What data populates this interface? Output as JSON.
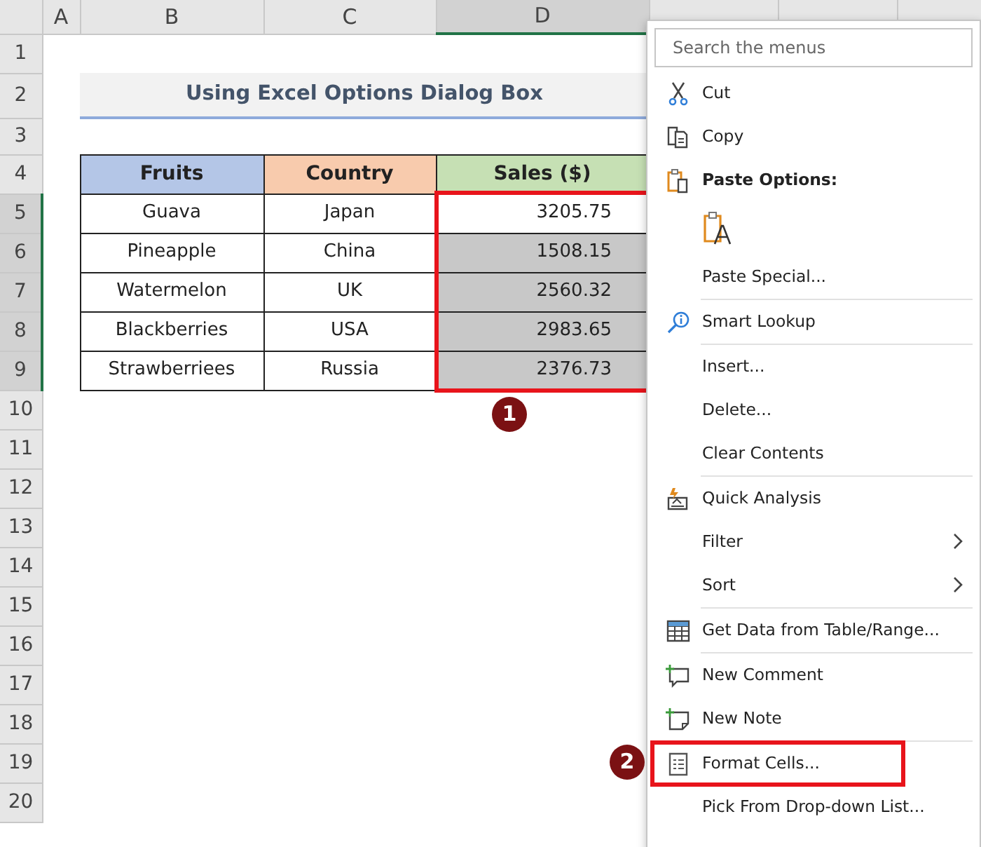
{
  "columns": [
    {
      "label": "A",
      "selected": false
    },
    {
      "label": "B",
      "selected": false
    },
    {
      "label": "C",
      "selected": false
    },
    {
      "label": "D",
      "selected": true
    }
  ],
  "rows": [
    {
      "label": "1",
      "selected": false
    },
    {
      "label": "2",
      "selected": false
    },
    {
      "label": "3",
      "selected": false
    },
    {
      "label": "4",
      "selected": false
    },
    {
      "label": "5",
      "selected": true
    },
    {
      "label": "6",
      "selected": true
    },
    {
      "label": "7",
      "selected": true
    },
    {
      "label": "8",
      "selected": true
    },
    {
      "label": "9",
      "selected": true
    },
    {
      "label": "10",
      "selected": false
    },
    {
      "label": "11",
      "selected": false
    },
    {
      "label": "12",
      "selected": false
    },
    {
      "label": "13",
      "selected": false
    },
    {
      "label": "14",
      "selected": false
    },
    {
      "label": "15",
      "selected": false
    },
    {
      "label": "16",
      "selected": false
    },
    {
      "label": "17",
      "selected": false
    },
    {
      "label": "18",
      "selected": false
    },
    {
      "label": "19",
      "selected": false
    },
    {
      "label": "20",
      "selected": false
    }
  ],
  "title": "Using Excel Options Dialog Box",
  "table": {
    "callout": "1",
    "headers": [
      {
        "label": "Fruits",
        "color": "#b4c6e7"
      },
      {
        "label": "Country",
        "color": "#f8cbad"
      },
      {
        "label": "Sales ($)",
        "color": "#c6e0b4"
      }
    ],
    "rows": [
      {
        "fruit": "Guava",
        "country": "Japan",
        "sales": "3205.75",
        "highlighted": false
      },
      {
        "fruit": "Pineapple",
        "country": "China",
        "sales": "1508.15",
        "highlighted": true
      },
      {
        "fruit": "Watermelon",
        "country": "UK",
        "sales": "2560.32",
        "highlighted": true
      },
      {
        "fruit": "Blackberries",
        "country": "USA",
        "sales": "2983.65",
        "highlighted": true
      },
      {
        "fruit": "Strawberriees",
        "country": "Russia",
        "sales": "2376.73",
        "highlighted": true
      }
    ]
  },
  "context_menu": [
    {
      "kind": "search",
      "placeholder": "Search the menus"
    },
    {
      "kind": "item",
      "label": "Cut",
      "submenu": false
    },
    {
      "kind": "item",
      "label": "Copy",
      "submenu": false
    },
    {
      "kind": "heading",
      "label": "Paste Options:"
    },
    {
      "kind": "paste-option"
    },
    {
      "kind": "item",
      "label": "Paste Special...",
      "submenu": false
    },
    {
      "kind": "separator"
    },
    {
      "kind": "item",
      "label": "Smart Lookup",
      "submenu": false
    },
    {
      "kind": "separator"
    },
    {
      "kind": "item",
      "label": "Insert...",
      "submenu": false
    },
    {
      "kind": "item",
      "label": "Delete...",
      "submenu": false
    },
    {
      "kind": "item",
      "label": "Clear Contents",
      "submenu": false
    },
    {
      "kind": "separator"
    },
    {
      "kind": "item",
      "label": "Quick Analysis",
      "submenu": false
    },
    {
      "kind": "item",
      "label": "Filter",
      "submenu": true
    },
    {
      "kind": "item",
      "label": "Sort",
      "submenu": true
    },
    {
      "kind": "separator"
    },
    {
      "kind": "item",
      "label": "Get Data from Table/Range...",
      "submenu": false
    },
    {
      "kind": "separator"
    },
    {
      "kind": "item",
      "label": "New Comment",
      "submenu": false
    },
    {
      "kind": "item",
      "label": "New Note",
      "submenu": false
    },
    {
      "kind": "separator"
    },
    {
      "kind": "item",
      "label": "Format Cells...",
      "submenu": false,
      "callout": "2"
    },
    {
      "kind": "item",
      "label": "Pick From Drop-down List...",
      "submenu": false
    }
  ]
}
